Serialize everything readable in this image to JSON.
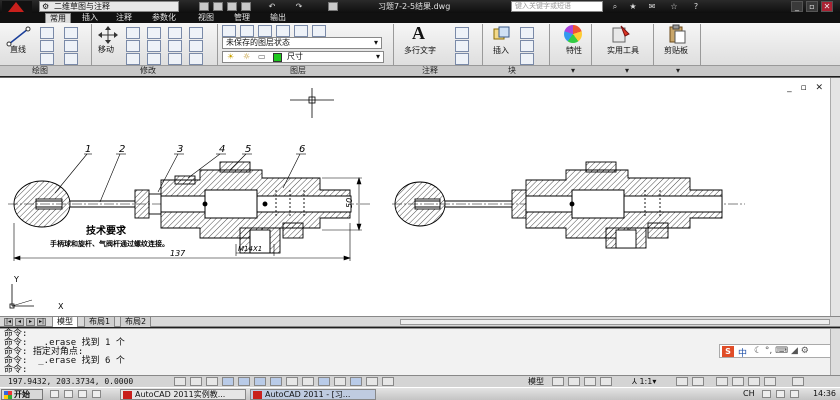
{
  "titlebar": {
    "workspace": "二维草图与注释",
    "document_title": "习题7-2-5结果.dwg",
    "search_placeholder": "键入关键字或短语"
  },
  "ribbon_tabs": [
    "常用",
    "插入",
    "注释",
    "参数化",
    "视图",
    "管理",
    "输出"
  ],
  "ribbon": {
    "line_label": "直线",
    "move_label": "移动",
    "layer_state": "未保存的图层状态",
    "layer_name": "尺寸",
    "mtext_label": "多行文字",
    "insert_label": "插入",
    "properties_label": "特性",
    "utilities_label": "实用工具",
    "clipboard_label": "剪贴板",
    "panels": [
      "绘图",
      "修改",
      "图层",
      "注释",
      "块"
    ]
  },
  "drawing": {
    "part_numbers": [
      "1",
      "2",
      "3",
      "4",
      "5",
      "6"
    ],
    "tech_title": "技术要求",
    "tech_note": "手柄球和旋杆、气阀杆通过螺纹连接。",
    "dim_137": "137",
    "dim_50": "50",
    "dim_thread": "M14X1",
    "ucs_y": "Y",
    "ucs_x": "X"
  },
  "layout_tabs": [
    "模型",
    "布局1",
    "布局2"
  ],
  "command_lines": [
    "命令:",
    "命令:  _.erase 找到 1 个",
    "命令: 指定对角点:",
    "命令:  _.erase 找到 6 个",
    "命令:"
  ],
  "ime": {
    "logo": "S",
    "mode": "中"
  },
  "status": {
    "coordinates": "197.9432, 203.3734, 0.0000",
    "model_label": "模型",
    "annotation_scale": "1:1"
  },
  "taskbar": {
    "start": "开始",
    "tasks": [
      "AutoCAD 2011实例教...",
      "AutoCAD 2011 - [习..."
    ],
    "clock": "14:36",
    "lang": "CH"
  },
  "colors": {
    "accent": "#c8201c",
    "layer_swatch": "#1ec81e"
  }
}
